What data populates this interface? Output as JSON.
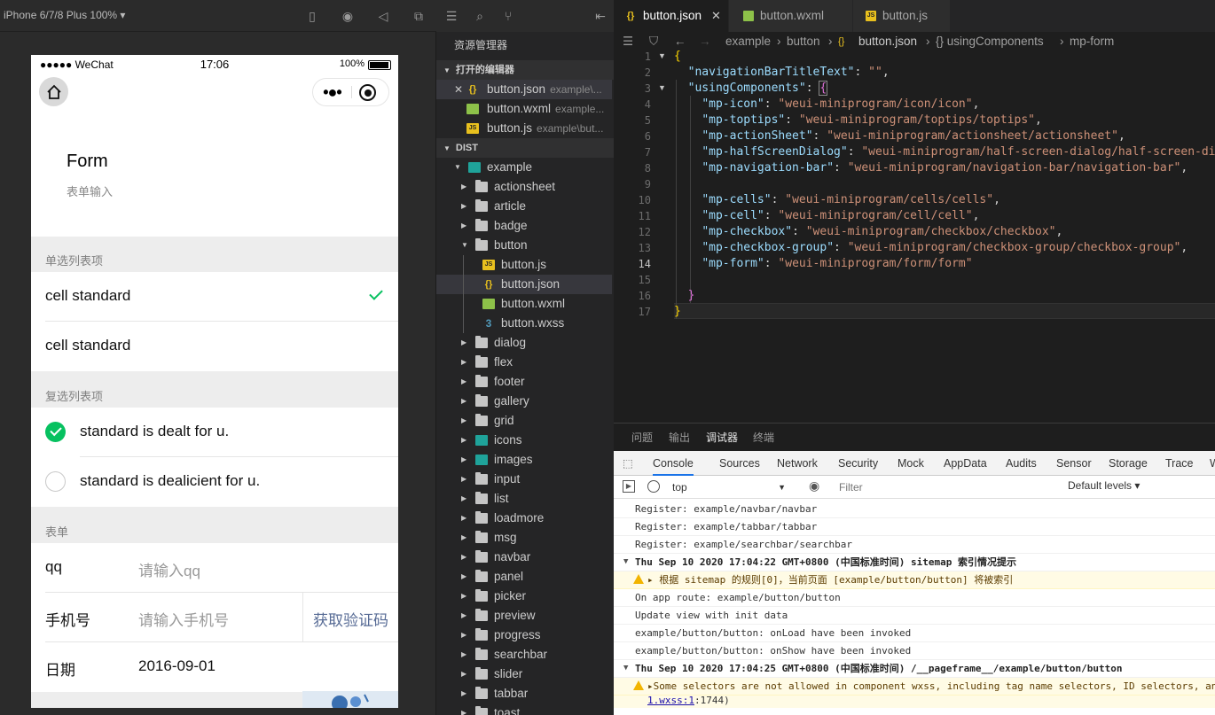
{
  "simulator": {
    "device": "iPhone 6/7/8 Plus 100% ▾",
    "status": {
      "carrier": "●●●●● WeChat",
      "time": "17:06",
      "battery": "100%"
    },
    "page": {
      "title": "Form",
      "desc": "表单输入"
    },
    "radio_group": {
      "title": "单选列表项",
      "items": [
        "cell standard",
        "cell standard"
      ],
      "selected_index": 0
    },
    "checkbox_group": {
      "title": "复选列表项",
      "items": [
        "standard is dealt for u.",
        "standard is dealicient for u."
      ],
      "checked": [
        true,
        false
      ]
    },
    "form_group": {
      "title": "表单",
      "qq_label": "qq",
      "qq_placeholder": "请输入qq",
      "phone_label": "手机号",
      "phone_placeholder": "请输入手机号",
      "vcode_button": "获取验证码",
      "date_label": "日期",
      "date_value": "2016-09-01"
    }
  },
  "explorer": {
    "title": "资源管理器",
    "open_editors_header": "打开的编辑器",
    "open_editors": [
      {
        "name": "button.json",
        "desc": "example\\..."
      },
      {
        "name": "button.wxml",
        "desc": "example..."
      },
      {
        "name": "button.js",
        "desc": "example\\but..."
      }
    ],
    "dist_header": "DIST",
    "root_folder": "example",
    "folders_before": [
      "actionsheet",
      "article",
      "badge"
    ],
    "open_folder": "button",
    "button_files": [
      "button.js",
      "button.json",
      "button.wxml",
      "button.wxss"
    ],
    "folders_after": [
      "dialog",
      "flex",
      "footer",
      "gallery",
      "grid",
      "icons",
      "images",
      "input",
      "list",
      "loadmore",
      "msg",
      "navbar",
      "panel",
      "picker",
      "preview",
      "progress",
      "searchbar",
      "slider",
      "tabbar",
      "toast"
    ]
  },
  "editor": {
    "tabs": [
      "button.json",
      "button.wxml",
      "button.js"
    ],
    "active_tab": 0,
    "breadcrumb": [
      "example",
      "button",
      "button.json",
      "{} usingComponents",
      "mp-form"
    ],
    "current_line": 14,
    "lines": [
      "{",
      "  \"navigationBarTitleText\": \"\",",
      "  \"usingComponents\": {",
      "    \"mp-icon\": \"weui-miniprogram/icon/icon\",",
      "    \"mp-toptips\": \"weui-miniprogram/toptips/toptips\",",
      "    \"mp-actionSheet\": \"weui-miniprogram/actionsheet/actionsheet\",",
      "    \"mp-halfScreenDialog\": \"weui-miniprogram/half-screen-dialog/half-screen-dialog\",",
      "    \"mp-navigation-bar\": \"weui-miniprogram/navigation-bar/navigation-bar\",",
      "",
      "    \"mp-cells\": \"weui-miniprogram/cells/cells\",",
      "    \"mp-cell\": \"weui-miniprogram/cell/cell\",",
      "    \"mp-checkbox\": \"weui-miniprogram/checkbox/checkbox\",",
      "    \"mp-checkbox-group\": \"weui-miniprogram/checkbox-group/checkbox-group\",",
      "    \"mp-form\": \"weui-miniprogram/form/form\"",
      "",
      "  }",
      "}"
    ]
  },
  "panel": {
    "tabs": [
      "问题",
      "输出",
      "调试器",
      "终端"
    ],
    "active_tab": 2,
    "devtools_tabs": [
      "Console",
      "Sources",
      "Network",
      "Security",
      "Mock",
      "AppData",
      "Audits",
      "Sensor",
      "Storage",
      "Trace",
      "W"
    ],
    "active_devtools_tab": 0,
    "context": "top",
    "filter_placeholder": "Filter",
    "levels": "Default levels ▾",
    "console": [
      {
        "type": "log",
        "text": "Register: example/navbar/navbar"
      },
      {
        "type": "log",
        "text": "Register: example/tabbar/tabbar"
      },
      {
        "type": "log",
        "text": "Register: example/searchbar/searchbar"
      },
      {
        "type": "group",
        "text": "Thu Sep 10 2020 17:04:22 GMT+0800 (中国标准时间) sitemap 索引情况提示"
      },
      {
        "type": "warn",
        "text": "▸ 根据 sitemap 的规则[0]，当前页面 [example/button/button] 将被索引"
      },
      {
        "type": "log",
        "text": "On app route: example/button/button"
      },
      {
        "type": "log",
        "text": "Update view with init data"
      },
      {
        "type": "log",
        "text": "example/button/button: onLoad have been invoked"
      },
      {
        "type": "log",
        "text": "example/button/button: onShow have been invoked"
      },
      {
        "type": "group",
        "text": "Thu Sep 10 2020 17:04:25 GMT+0800 (中国标准时间) /__pageframe__/example/button/button"
      },
      {
        "type": "warn",
        "text": "▸Some selectors are not allowed in component wxss, including tag name selectors, ID selectors, and attribute selectors."
      },
      {
        "type": "link",
        "text": "1.wxss:1",
        "suffix": ":1744)"
      }
    ]
  },
  "colors": {
    "accent": "#07c160",
    "link": "#576b95",
    "selection": "#37373d",
    "devtools_active": "#1a73e8"
  }
}
